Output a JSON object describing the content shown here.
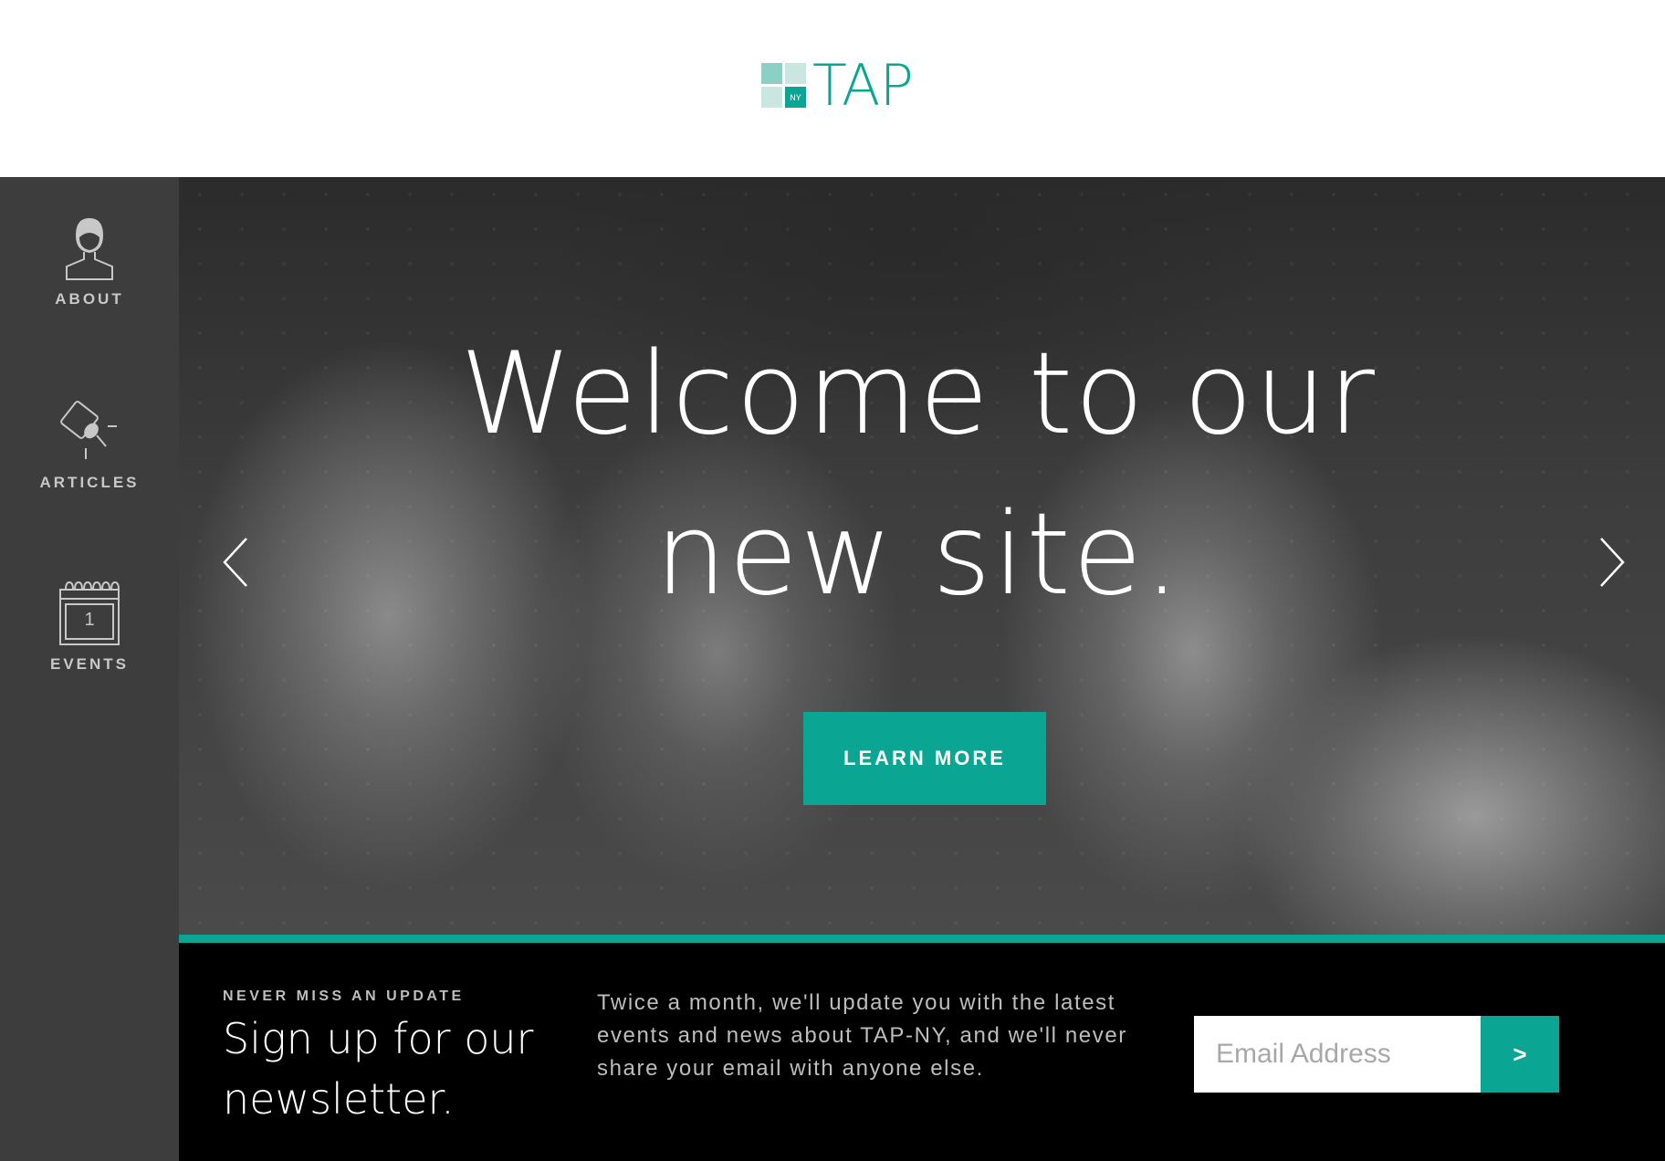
{
  "header": {
    "logo_badge": "NY",
    "logo_text": "TAP"
  },
  "sidebar": {
    "items": [
      {
        "label": "ABOUT",
        "icon": "person-icon"
      },
      {
        "label": "ARTICLES",
        "icon": "articles-icon"
      },
      {
        "label": "EVENTS",
        "icon": "calendar-icon",
        "calendar_day": "1"
      }
    ]
  },
  "hero": {
    "title": "Welcome to our new site.",
    "cta_label": "LEARN MORE",
    "prev_icon": "chevron-left-icon",
    "next_icon": "chevron-right-icon"
  },
  "newsletter": {
    "eyebrow": "NEVER MISS AN UPDATE",
    "heading": "Sign up for our newsletter.",
    "copy": "Twice a month, we'll update you with the latest events and news about TAP-NY, and we'll never share your email with anyone else.",
    "email_placeholder": "Email Address",
    "submit_label": ">"
  },
  "colors": {
    "accent": "#0aa693",
    "sidebar_bg": "#3d3d3d",
    "newsletter_bg": "#000000"
  }
}
